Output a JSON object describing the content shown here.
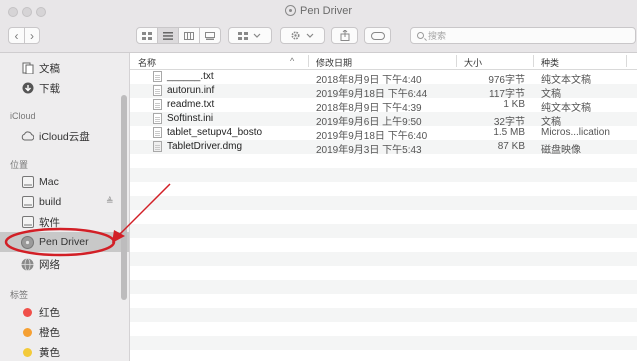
{
  "window": {
    "title": "Pen Driver"
  },
  "toolbar": {
    "back_icon": "‹",
    "forward_icon": "›",
    "search_placeholder": "搜索"
  },
  "sidebar": {
    "items": [
      {
        "label": "文稿",
        "icon": "documents-icon"
      },
      {
        "label": "下载",
        "icon": "downloads-icon"
      }
    ],
    "icloud_header": "iCloud",
    "icloud_items": [
      {
        "label": "iCloud云盘",
        "icon": "cloud-icon"
      }
    ],
    "locations_header": "位置",
    "locations": [
      {
        "label": "Mac",
        "icon": "disk-icon"
      },
      {
        "label": "build",
        "icon": "disk-icon",
        "eject": "≜"
      },
      {
        "label": "软件",
        "icon": "disk-icon"
      },
      {
        "label": "Pen Driver",
        "icon": "optical-disc-icon",
        "selected": true
      },
      {
        "label": "网络",
        "icon": "network-icon"
      }
    ],
    "tags_header": "标签",
    "tags": [
      {
        "label": "红色",
        "color": "#f0504a"
      },
      {
        "label": "橙色",
        "color": "#f5a033"
      },
      {
        "label": "黄色",
        "color": "#f3ca3a"
      }
    ]
  },
  "list": {
    "columns": {
      "name": "名称",
      "date": "修改日期",
      "size": "大小",
      "kind": "种类",
      "sort_indicator": "^"
    },
    "rows": [
      {
        "name": "______.txt",
        "date": "2018年8月9日 下午4:40",
        "size": "976字节",
        "kind": "纯文本文稿"
      },
      {
        "name": "autorun.inf",
        "date": "2019年9月18日 下午6:44",
        "size": "117字节",
        "kind": "文稿"
      },
      {
        "name": "readme.txt",
        "date": "2018年8月9日 下午4:39",
        "size": "1 KB",
        "kind": "纯文本文稿"
      },
      {
        "name": "Softinst.ini",
        "date": "2019年9月6日 上午9:50",
        "size": "32字节",
        "kind": "文稿"
      },
      {
        "name": "tablet_setupv4_bosto",
        "date": "2019年9月18日 下午6:40",
        "size": "1.5 MB",
        "kind": "Micros...lication"
      },
      {
        "name": "TabletDriver.dmg",
        "date": "2019年9月3日 下午5:43",
        "size": "87 KB",
        "kind": "磁盘映像"
      }
    ]
  },
  "colors": {
    "highlight_ring": "#d21f26",
    "selection": "#c8c8c8",
    "accent": "#1e6fe0"
  }
}
